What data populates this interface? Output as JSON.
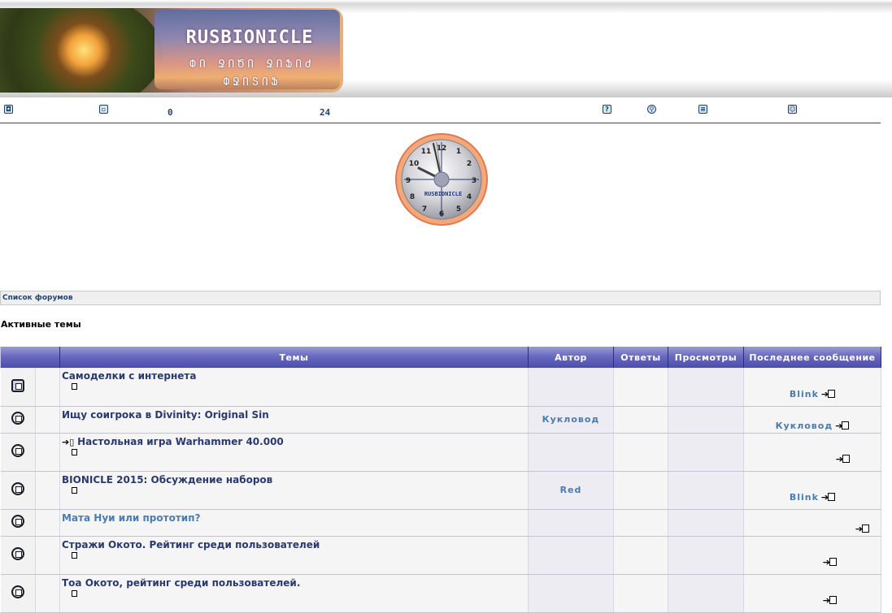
{
  "header": {
    "logo_title": "RUSBIONICLE",
    "logo_sub1": "ՓՈ ՋՈԾՈ ՋՈՖՈԺ",
    "logo_sub2": "ՓՋՈՏՈՖ"
  },
  "navbar": {
    "count_a": "0",
    "count_b": "24"
  },
  "clock": {
    "label": "RUSBIONICLE",
    "numbers": [
      "12",
      "1",
      "2",
      "3",
      "4",
      "5",
      "6",
      "7",
      "8",
      "9",
      "10",
      "11"
    ]
  },
  "breadcrumb": {
    "forum_index": "Список форумов"
  },
  "section_title": "Активные темы",
  "table": {
    "headers": {
      "topics": "Темы",
      "author": "Автор",
      "replies": "Ответы",
      "views": "Просмотры",
      "last_post": "Последнее сообщение"
    },
    "rows": [
      {
        "title": "Самоделки с интернета",
        "author": "",
        "last_user": "Blink",
        "has_page": true,
        "prefix": false,
        "icon": "sticky-topic-icon"
      },
      {
        "title": "Ищу соигрока в Divinity: Original Sin",
        "author": "Кукловод",
        "last_user": "Кукловод",
        "has_page": false,
        "prefix": false,
        "icon": "topic-icon"
      },
      {
        "title": "Настольная игра Warhammer 40.000",
        "author": "",
        "last_user": "",
        "has_page": true,
        "prefix": true,
        "icon": "topic-icon"
      },
      {
        "title": "BIONICLE 2015: Обсуждение наборов",
        "author": "Red",
        "last_user": "Blink",
        "has_page": true,
        "prefix": false,
        "icon": "topic-icon"
      },
      {
        "title": "Мата Нуи или прототип?",
        "author": "",
        "last_user": "",
        "has_page": false,
        "prefix": false,
        "icon": "topic-icon"
      },
      {
        "title": "Стражи Окото. Рейтинг среди пользователей",
        "author": "",
        "last_user": "",
        "has_page": true,
        "prefix": false,
        "icon": "topic-icon"
      },
      {
        "title": "Тоа Окото, рейтинг среди пользователей.",
        "author": "",
        "last_user": "",
        "has_page": true,
        "prefix": false,
        "icon": "topic-icon"
      }
    ]
  }
}
